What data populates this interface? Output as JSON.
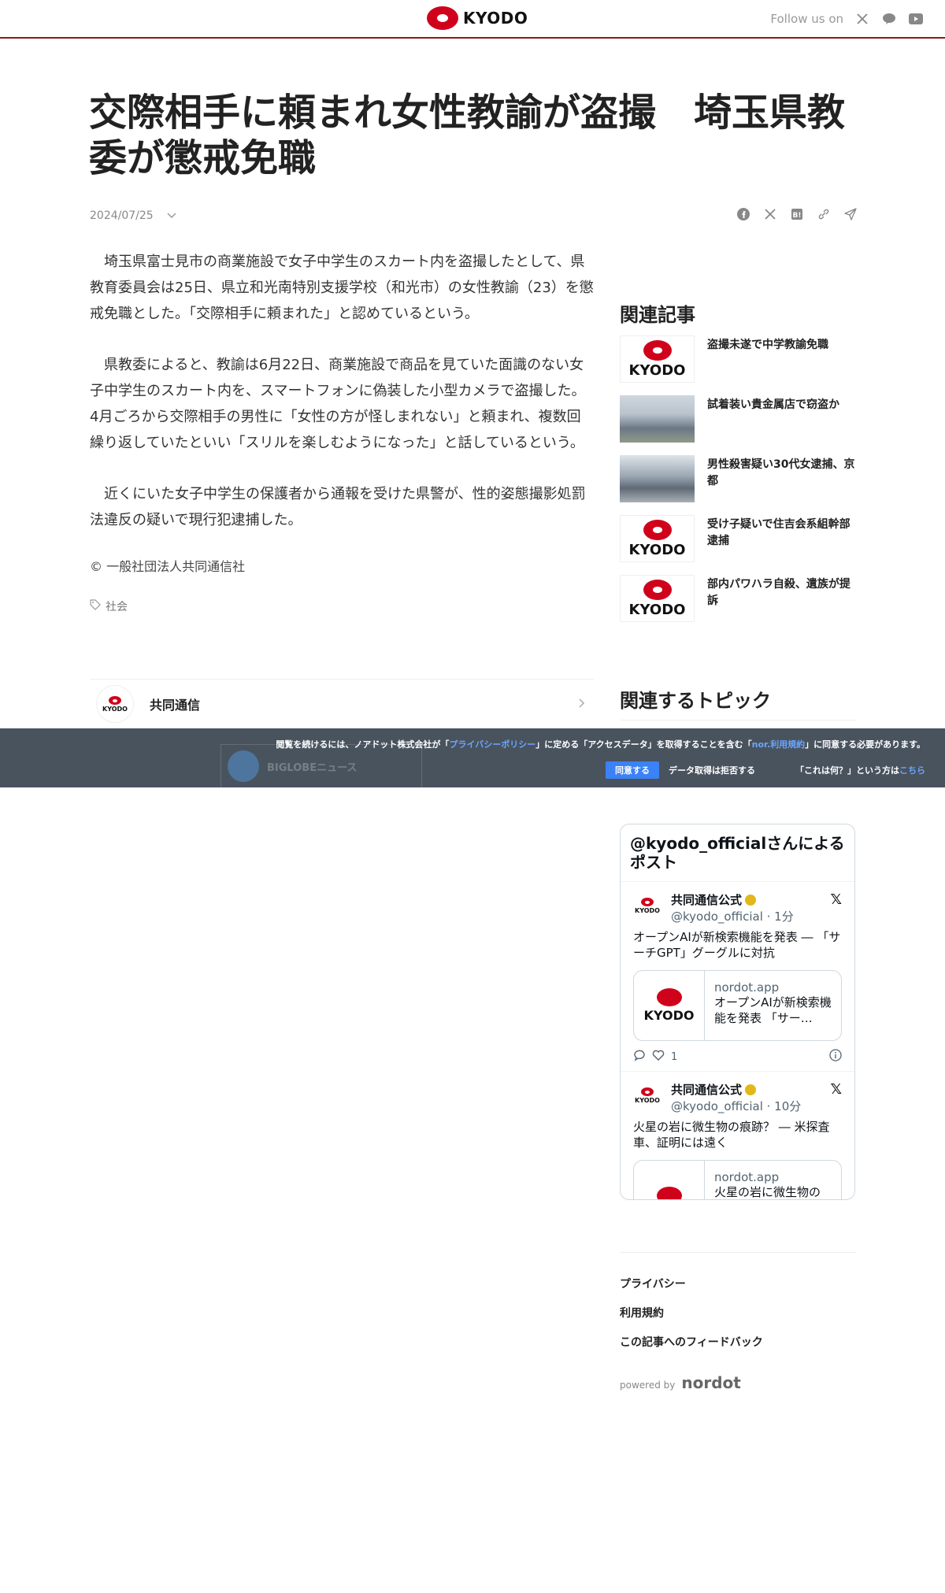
{
  "header": {
    "logo_text": "KYODO",
    "follow_label": "Follow us on",
    "social_icons": [
      "x-icon",
      "line-icon",
      "youtube-icon"
    ],
    "accent_color": "#d0021b"
  },
  "article": {
    "title": "交際相手に頼まれ女性教諭が盗撮　埼玉県教委が懲戒免職",
    "date": "2024/07/25",
    "share_icons": [
      "facebook-icon",
      "x-icon",
      "hatena-icon",
      "link-icon",
      "send-icon"
    ],
    "paragraphs": [
      "　埼玉県富士見市の商業施設で女子中学生のスカート内を盗撮したとして、県教育委員会は25日、県立和光南特別支援学校（和光市）の女性教諭（23）を懲戒免職とした。「交際相手に頼まれた」と認めているという。",
      "　県教委によると、教諭は6月22日、商業施設で商品を見ていた面識のない女子中学生のスカート内を、スマートフォンに偽装した小型カメラで盗撮した。4月ごろから交際相手の男性に「女性の方が怪しまれない」と頼まれ、複数回繰り返していたといい「スリルを楽しむようになった」と話しているという。",
      "　近くにいた女子中学生の保護者から通報を受けた県警が、性的姿態撮影処罰法違反の疑いで現行犯逮捕した。"
    ],
    "copyright": "© 一般社団法人共同通信社",
    "tag": "社会",
    "source_name": "共同通信",
    "source_logo_text": "KYODO"
  },
  "sidebar": {
    "related_heading": "関連記事",
    "related": [
      {
        "title": "盗撮未遂で中学教諭免職",
        "thumb": "kyodo-logo"
      },
      {
        "title": "試着装い貴金属店で窃盗か",
        "thumb": "photo"
      },
      {
        "title": "男性殺害疑い30代女逮捕、京都",
        "thumb": "photo"
      },
      {
        "title": "受け子疑いで住吉会系組幹部逮捕",
        "thumb": "kyodo-logo"
      },
      {
        "title": "部内パワハラ自殺、遺族が提訴",
        "thumb": "kyodo-logo"
      }
    ],
    "topics_heading": "関連するトピック"
  },
  "consent": {
    "text_before": "閲覧を続けるには、ノアドット株式会社が「",
    "privacy_link": "プライバシーポリシー",
    "text_middle": "」に定める「アクセスデータ」を取得することを含む「",
    "terms_link": "nor.利用規約",
    "text_after": "」に同意する必要があります。",
    "agree_label": "同意する",
    "decline_label": "データ取得は拒否する",
    "what_text": "「これは何？」という方は",
    "what_link": "こちら",
    "ghost_label": "BIGLOBEニュース"
  },
  "tweets": {
    "heading": "@kyodo_officialさんによるポスト",
    "items": [
      {
        "name": "共同通信公式",
        "handle": "@kyodo_official · 1分",
        "text": "オープンAIが新検索機能を発表 ― 「サーチGPT」グーグルに対抗",
        "card_domain": "nordot.app",
        "card_title": "オープンAIが新検索機能を発表 「サー…",
        "likes": "1"
      },
      {
        "name": "共同通信公式",
        "handle": "@kyodo_official · 10分",
        "text": "火星の岩に微生物の痕跡？ ― 米探査車、証明には遠く",
        "card_domain": "nordot.app",
        "card_title": "火星の岩に微生物の"
      }
    ]
  },
  "footer": {
    "links": [
      "プライバシー",
      "利用規約",
      "この記事へのフィードバック"
    ],
    "powered_label": "powered by",
    "powered_brand": "nordot"
  }
}
